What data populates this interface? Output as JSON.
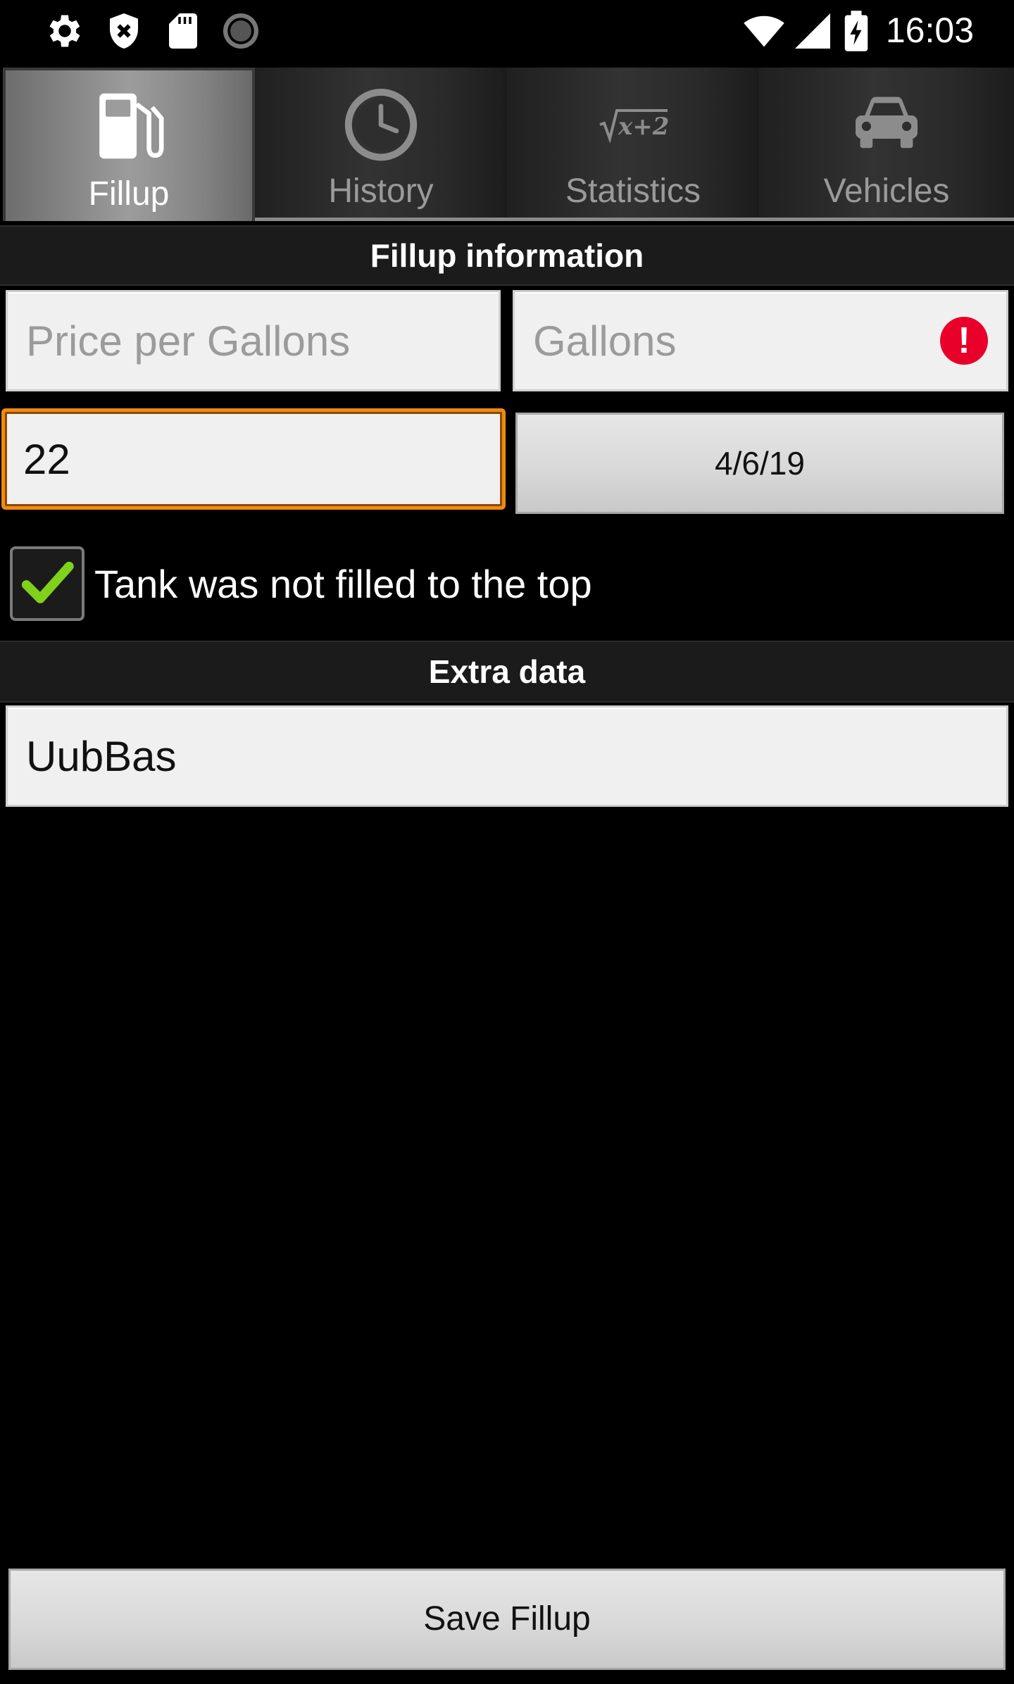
{
  "status_bar": {
    "time": "16:03",
    "left_icons": [
      "gear-icon",
      "shield-close-icon",
      "sd-card-icon",
      "sync-spinner-icon"
    ],
    "right_icons": [
      "wifi-icon",
      "cell-signal-icon",
      "battery-charging-icon"
    ]
  },
  "tabs": [
    {
      "label": "Fillup",
      "icon": "gas-pump-icon",
      "active": true
    },
    {
      "label": "History",
      "icon": "clock-icon",
      "active": false
    },
    {
      "label": "Statistics",
      "icon": "math-formula-icon",
      "active": false
    },
    {
      "label": "Vehicles",
      "icon": "car-icon",
      "active": false
    }
  ],
  "fillup_section": {
    "title": "Fillup information",
    "price_per_gallon": {
      "value": "",
      "placeholder": "Price per Gallons"
    },
    "gallons": {
      "value": "",
      "placeholder": "Gallons",
      "error_glyph": "!"
    },
    "odometer": {
      "value": "22"
    },
    "date_button_label": "4/6/19",
    "partial_fill_checkbox": {
      "label": "Tank was not filled to the top",
      "checked": true
    }
  },
  "extra_section": {
    "title": "Extra data",
    "comment": {
      "value": "UubBas"
    }
  },
  "save_button_label": "Save Fillup",
  "colors": {
    "focus_border": "#ef8a12",
    "error": "#e8002b",
    "check": "#7fd11b"
  }
}
